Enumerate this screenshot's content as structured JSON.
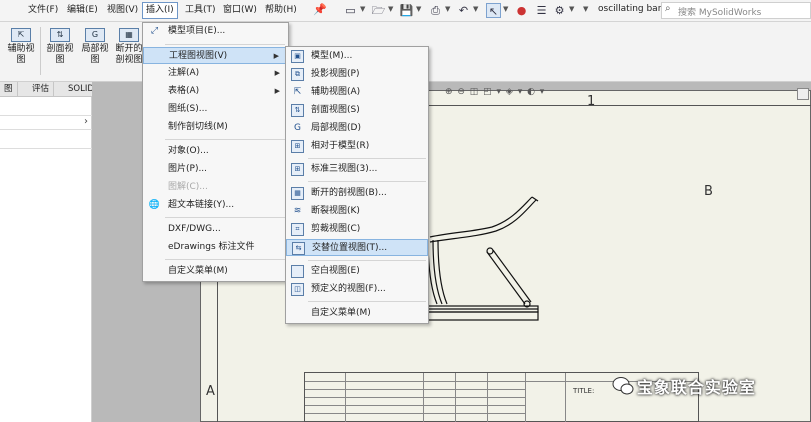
{
  "menubar": {
    "items": [
      "文件(F)",
      "编辑(E)",
      "视图(V)",
      "插入(I)",
      "工具(T)",
      "窗口(W)",
      "帮助(H)"
    ],
    "document_title": "oscillating bar - ...",
    "search_placeholder": "搜索 MySolidWorks"
  },
  "ribbon": {
    "buttons": [
      "辅助视\n图",
      "剖面视\n图",
      "局部视\n图",
      "断开的\n剖视图"
    ]
  },
  "tabs": [
    "图",
    "评估",
    "SOLIDWORKS 插件"
  ],
  "insert_menu": {
    "items": [
      {
        "label": "模型项目(E)...",
        "icon": "model-items-icon",
        "disabled": false,
        "submenu": false
      },
      {
        "label": "工程图视图(V)",
        "icon": "",
        "disabled": false,
        "submenu": true
      },
      {
        "label": "注解(A)",
        "icon": "",
        "disabled": false,
        "submenu": true
      },
      {
        "label": "表格(A)",
        "icon": "",
        "disabled": false,
        "submenu": true
      },
      {
        "label": "图纸(S)...",
        "icon": "",
        "disabled": false,
        "submenu": false
      },
      {
        "label": "制作剖切线(M)",
        "icon": "",
        "disabled": false,
        "submenu": false
      },
      {
        "label": "对象(O)...",
        "icon": "",
        "disabled": false,
        "submenu": false
      },
      {
        "label": "图片(P)...",
        "icon": "",
        "disabled": false,
        "submenu": false
      },
      {
        "label": "图解(C)...",
        "icon": "",
        "disabled": true,
        "submenu": false
      },
      {
        "label": "超文本链接(Y)...",
        "icon": "hyperlink-icon",
        "disabled": false,
        "submenu": false
      },
      {
        "label": "DXF/DWG...",
        "icon": "",
        "disabled": false,
        "submenu": false
      },
      {
        "label": "eDrawings 标注文件",
        "icon": "",
        "disabled": false,
        "submenu": false
      },
      {
        "label": "自定义菜单(M)",
        "icon": "",
        "disabled": false,
        "submenu": false
      }
    ]
  },
  "drawing_view_submenu": {
    "items": [
      {
        "label": "模型(M)...",
        "icon": "model-view-icon"
      },
      {
        "label": "投影视图(P)",
        "icon": "projected-view-icon"
      },
      {
        "label": "辅助视图(A)",
        "icon": "auxiliary-view-icon"
      },
      {
        "label": "剖面视图(S)",
        "icon": "section-view-icon"
      },
      {
        "label": "局部视图(D)",
        "icon": "detail-view-icon"
      },
      {
        "label": "相对于模型(R)",
        "icon": "relative-view-icon"
      },
      {
        "label": "标准三视图(3)...",
        "icon": "standard-3view-icon"
      },
      {
        "label": "断开的剖视图(B)...",
        "icon": "broken-out-section-icon"
      },
      {
        "label": "断裂视图(K)",
        "icon": "break-view-icon"
      },
      {
        "label": "剪裁视图(C)",
        "icon": "crop-view-icon"
      },
      {
        "label": "交替位置视图(T)...",
        "icon": "alternate-position-icon"
      },
      {
        "label": "空白视图(E)",
        "icon": "empty-view-icon"
      },
      {
        "label": "预定义的视图(F)...",
        "icon": "predefined-view-icon"
      },
      {
        "label": "自定义菜单(M)",
        "icon": ""
      }
    ],
    "highlighted_index": 10
  },
  "sheet": {
    "zone_labels": [
      "1",
      "B",
      "A"
    ],
    "title_label": "TITLE:"
  },
  "watermark": {
    "text": "宝象联合实验室"
  }
}
